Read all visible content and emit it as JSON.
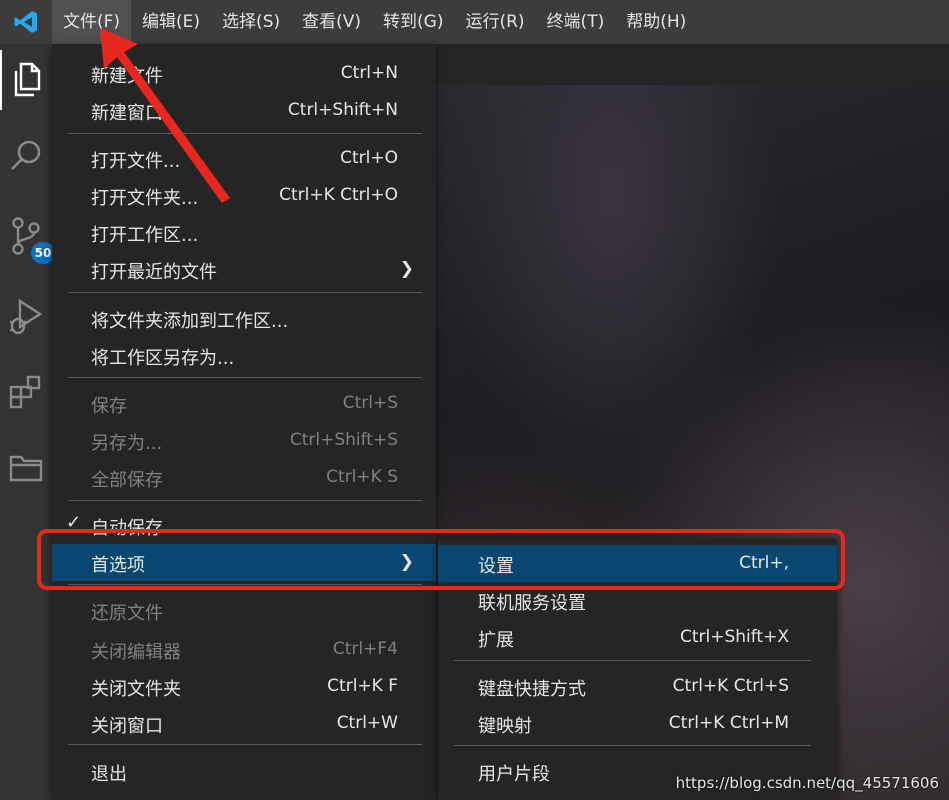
{
  "menubar": {
    "items": [
      "文件(F)",
      "编辑(E)",
      "选择(S)",
      "查看(V)",
      "转到(G)",
      "运行(R)",
      "终端(T)",
      "帮助(H)"
    ]
  },
  "activity_bar": {
    "source_control_badge": "50"
  },
  "file_menu": {
    "new_file": {
      "label": "新建文件",
      "shortcut": "Ctrl+N"
    },
    "new_window": {
      "label": "新建窗口",
      "shortcut": "Ctrl+Shift+N"
    },
    "open_file": {
      "label": "打开文件...",
      "shortcut": "Ctrl+O"
    },
    "open_folder": {
      "label": "打开文件夹...",
      "shortcut": "Ctrl+K Ctrl+O"
    },
    "open_workspace": {
      "label": "打开工作区..."
    },
    "open_recent": {
      "label": "打开最近的文件"
    },
    "add_folder": {
      "label": "将文件夹添加到工作区..."
    },
    "save_workspace_as": {
      "label": "将工作区另存为..."
    },
    "save": {
      "label": "保存",
      "shortcut": "Ctrl+S"
    },
    "save_as": {
      "label": "另存为...",
      "shortcut": "Ctrl+Shift+S"
    },
    "save_all": {
      "label": "全部保存",
      "shortcut": "Ctrl+K S"
    },
    "auto_save": {
      "label": "自动保存"
    },
    "preferences": {
      "label": "首选项"
    },
    "revert": {
      "label": "还原文件"
    },
    "close_editor": {
      "label": "关闭编辑器",
      "shortcut": "Ctrl+F4"
    },
    "close_folder": {
      "label": "关闭文件夹",
      "shortcut": "Ctrl+K F"
    },
    "close_window": {
      "label": "关闭窗口",
      "shortcut": "Ctrl+W"
    },
    "exit": {
      "label": "退出"
    }
  },
  "preferences_submenu": {
    "settings": {
      "label": "设置",
      "shortcut": "Ctrl+,"
    },
    "online_services": {
      "label": "联机服务设置"
    },
    "extensions": {
      "label": "扩展",
      "shortcut": "Ctrl+Shift+X"
    },
    "keyboard_shortcuts": {
      "label": "键盘快捷方式",
      "shortcut": "Ctrl+K Ctrl+S"
    },
    "keymaps": {
      "label": "键映射",
      "shortcut": "Ctrl+K Ctrl+M"
    },
    "user_snippets": {
      "label": "用户片段"
    }
  },
  "watermark": "https://blog.csdn.net/qq_45571606",
  "colors": {
    "accent_selection": "#094771",
    "annotation": "#e8281e",
    "badge": "#0e70c0",
    "logo": "#23a9f2"
  }
}
